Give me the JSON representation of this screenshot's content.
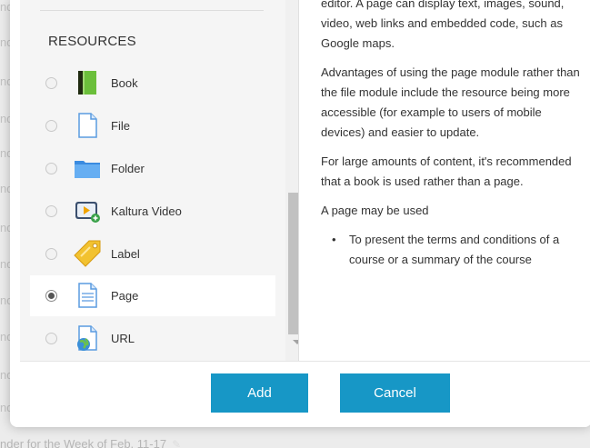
{
  "background": {
    "fragment": "nde",
    "fragments_count": 11,
    "bottom_text": "nder for the Week of Feb. 11-17"
  },
  "chooser": {
    "section_header": "RESOURCES",
    "options": [
      {
        "label": "Book",
        "icon": "book-icon",
        "selected": false
      },
      {
        "label": "File",
        "icon": "file-icon",
        "selected": false
      },
      {
        "label": "Folder",
        "icon": "folder-icon",
        "selected": false
      },
      {
        "label": "Kaltura Video",
        "icon": "kaltura-video-icon",
        "selected": false
      },
      {
        "label": "Label",
        "icon": "label-icon",
        "selected": false
      },
      {
        "label": "Page",
        "icon": "page-icon",
        "selected": true
      },
      {
        "label": "URL",
        "icon": "url-icon",
        "selected": false
      }
    ]
  },
  "help": {
    "intro": "editor. A page can display text, images, sound, video, web links and embedded code, such as Google maps.",
    "advantages": "Advantages of using the page module rather than the file module include the resource being more accessible (for example to users of mobile devices) and easier to update.",
    "large_content": "For large amounts of content, it's recommended that a book is used rather than a page.",
    "uses_heading": "A page may be used",
    "uses": [
      "To present the terms and conditions of a course or a summary of the course"
    ]
  },
  "footer": {
    "add_label": "Add",
    "cancel_label": "Cancel"
  },
  "colors": {
    "button": "#1797c6",
    "left_panel": "#f5f5f5"
  }
}
